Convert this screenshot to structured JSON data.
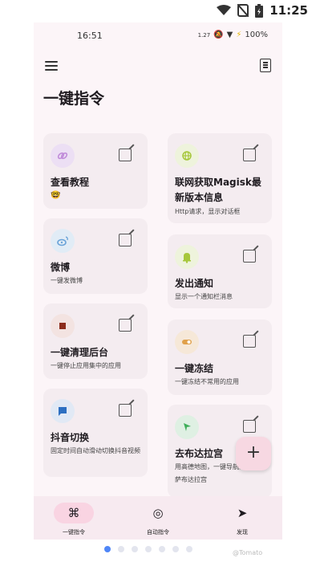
{
  "outer_status": {
    "time": "11:25"
  },
  "inner_status": {
    "time": "16:51",
    "speed": "1.27",
    "battery": "100%"
  },
  "page": {
    "title": "一键指令"
  },
  "cards_left": [
    {
      "title": "查看教程",
      "desc": "🤓",
      "icon": "link-icon",
      "color": "#c08bd9",
      "bubble": "#ecdff4"
    },
    {
      "title": "微博",
      "desc": "一键发微博",
      "icon": "weibo-icon",
      "color": "#6aa3d8",
      "bubble": "#e1ecf6"
    },
    {
      "title": "一键清理后台",
      "desc": "一键停止应用集中的应用",
      "icon": "stop-icon",
      "color": "#8c2c1c",
      "bubble": "#f3e3e1"
    },
    {
      "title": "抖音切换",
      "desc": "固定时间自动滑动切换抖音视频",
      "icon": "chat-icon",
      "color": "#2d6fc1",
      "bubble": "#e1e9f5"
    }
  ],
  "cards_right": [
    {
      "title": "联网获取Magisk最新版本信息",
      "desc": "Http请求，显示对话框",
      "icon": "globe-icon",
      "color": "#a6c73b",
      "bubble": "#eef3dc"
    },
    {
      "title": "发出通知",
      "desc": "显示一个通知栏消息",
      "icon": "bell-icon",
      "color": "#a6c73b",
      "bubble": "#eef3dc"
    },
    {
      "title": "一键冻结",
      "desc": "一键冻结不常用的应用",
      "icon": "toggle-icon",
      "color": "#e0a04a",
      "bubble": "#f6e8d8"
    },
    {
      "title": "去布达拉宫",
      "desc": "用高德地图，一键导航到萨布达拉宫",
      "icon": "navigation-icon",
      "color": "#3fae5a",
      "bubble": "#dff0e3"
    }
  ],
  "fab": {
    "label": "+"
  },
  "nav": [
    {
      "label": "一键指令",
      "glyph": "⌘"
    },
    {
      "label": "自动指令",
      "glyph": "◎"
    },
    {
      "label": "发现",
      "glyph": "➤"
    }
  ],
  "watermark": "@Tomato"
}
